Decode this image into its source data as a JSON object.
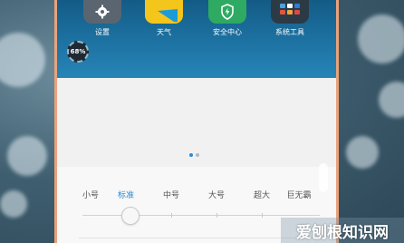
{
  "home_screen": {
    "apps": [
      {
        "label": "设置",
        "icon": "gear-icon"
      },
      {
        "label": "天气",
        "icon": "weather-icon"
      },
      {
        "label": "安全中心",
        "icon": "security-shield-icon"
      },
      {
        "label": "系统工具",
        "icon": "system-tools-folder-icon"
      }
    ],
    "memory_widget": "68%"
  },
  "page_indicator": {
    "pages": 2,
    "active": 1
  },
  "font_size_picker": {
    "options": [
      "小号",
      "标准",
      "中号",
      "大号",
      "超大",
      "巨无霸"
    ],
    "selected": "标准",
    "selected_index": 1
  },
  "watermark": "爱刨根知识网",
  "colors": {
    "accent": "#2a8bd6",
    "home_bg": "#1d73a3",
    "phone_frame": "#e9a27c"
  }
}
